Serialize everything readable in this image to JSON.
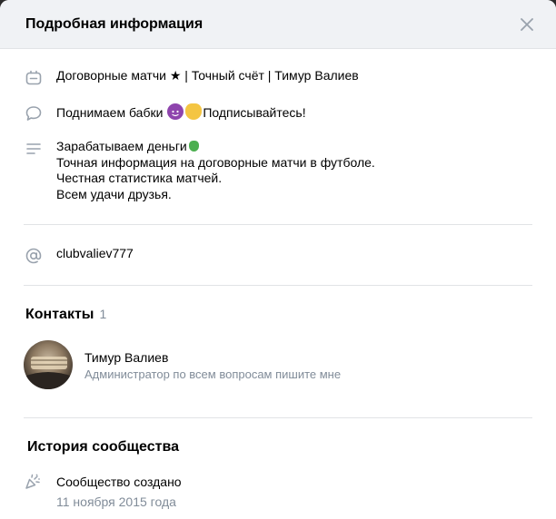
{
  "header": {
    "title": "Подробная информация"
  },
  "info": {
    "status": "Договорные матчи ★ | Точный счёт | Тимур Валиев",
    "slogan_part1": "Поднимаем бабки",
    "slogan_part2": "Подписывайтесь!",
    "description_line1": "Зарабатываем деньги",
    "description_line2": "Точная информация на договорные матчи в футболе.",
    "description_line3": "Честная статистика матчей.",
    "description_line4": "Всем удачи друзья.",
    "screen_name": "clubvaliev777"
  },
  "contacts": {
    "title": "Контакты",
    "count": "1",
    "items": [
      {
        "name": "Тимур Валиев",
        "role": "Администратор по всем вопросам пишите мне"
      }
    ]
  },
  "history": {
    "title": "История сообщества",
    "event_label": "Сообщество создано",
    "event_date": "11 ноября 2015 года"
  },
  "icons": {
    "status": "status-icon",
    "slogan": "speech-bubble-icon",
    "description": "text-lines-icon",
    "screen_name": "at-sign-icon",
    "history": "party-popper-icon",
    "close": "close-icon"
  },
  "colors": {
    "accent": "#99a2ad",
    "secondary_text": "#818c99",
    "header_bg": "#f0f2f5"
  }
}
